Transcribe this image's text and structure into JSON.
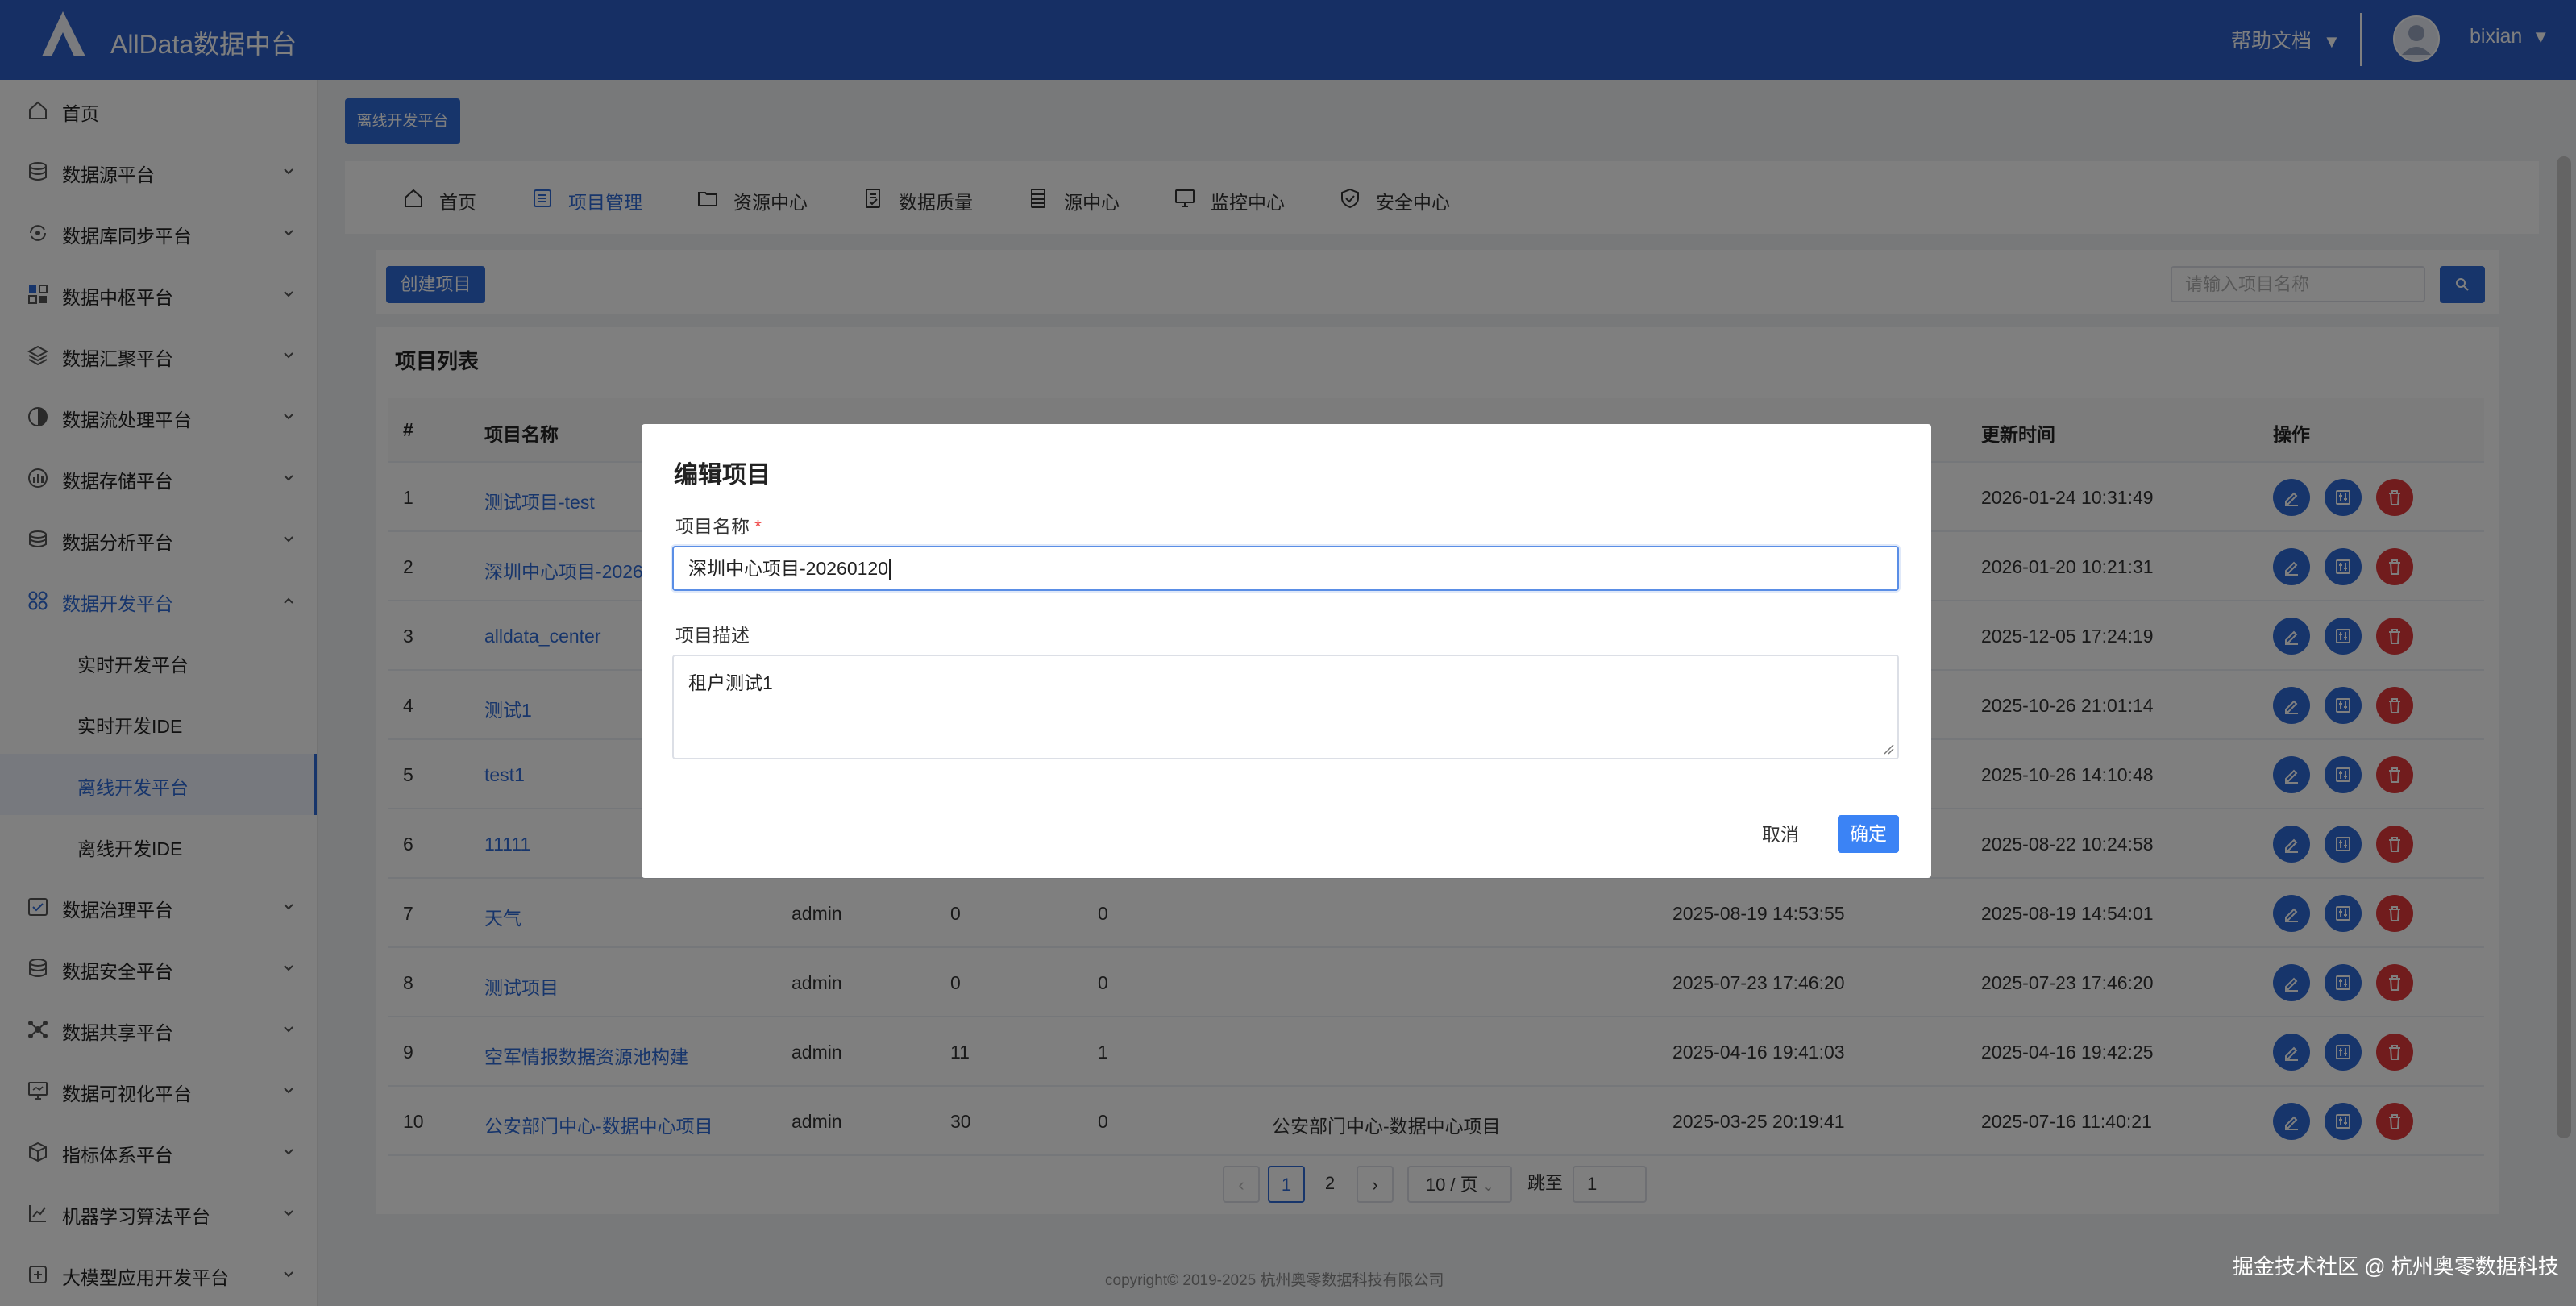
{
  "app": {
    "title": "AllData数据中台",
    "help_label": "帮助文档",
    "user_name": "bixian",
    "caret": "▼"
  },
  "sidebar": {
    "items": [
      {
        "label": "首页",
        "icon": "home-icon"
      },
      {
        "label": "数据源平台",
        "icon": "database-icon"
      },
      {
        "label": "数据库同步平台",
        "icon": "sync-icon"
      },
      {
        "label": "数据中枢平台",
        "icon": "grid-icon"
      },
      {
        "label": "数据汇聚平台",
        "icon": "layers-icon"
      },
      {
        "label": "数据流处理平台",
        "icon": "stream-icon"
      },
      {
        "label": "数据存储平台",
        "icon": "storage-icon"
      },
      {
        "label": "数据分析平台",
        "icon": "analysis-icon"
      },
      {
        "label": "数据开发平台",
        "icon": "apps-icon"
      },
      {
        "label": "实时开发平台"
      },
      {
        "label": "实时开发IDE"
      },
      {
        "label": "离线开发平台"
      },
      {
        "label": "离线开发IDE"
      },
      {
        "label": "数据治理平台",
        "icon": "governance-icon"
      },
      {
        "label": "数据安全平台",
        "icon": "security-icon"
      },
      {
        "label": "数据共享平台",
        "icon": "share-icon"
      },
      {
        "label": "数据可视化平台",
        "icon": "monitor-icon"
      },
      {
        "label": "指标体系平台",
        "icon": "cube-icon"
      },
      {
        "label": "机器学习算法平台",
        "icon": "ml-icon"
      },
      {
        "label": "大模型应用开发平台",
        "icon": "llm-icon"
      }
    ]
  },
  "page_tag": "离线开发平台",
  "topnav": {
    "items": [
      {
        "label": "首页",
        "icon": "home-icon"
      },
      {
        "label": "项目管理",
        "icon": "list-icon"
      },
      {
        "label": "资源中心",
        "icon": "folder-icon"
      },
      {
        "label": "数据质量",
        "icon": "doc-check-icon"
      },
      {
        "label": "源中心",
        "icon": "table-icon"
      },
      {
        "label": "监控中心",
        "icon": "monitor-icon"
      },
      {
        "label": "安全中心",
        "icon": "shield-icon"
      }
    ],
    "active": "项目管理"
  },
  "toolbar": {
    "create_label": "创建项目",
    "search_placeholder": "请输入项目名称"
  },
  "list": {
    "title": "项目列表",
    "columns": [
      "#",
      "项目名称",
      "更新时间",
      "操作"
    ],
    "rows": [
      {
        "no": "1",
        "name": "测试项目-test",
        "owner": "",
        "c1": "",
        "c2": "",
        "desc": "",
        "created": "",
        "updated": "2026-01-24 10:31:49"
      },
      {
        "no": "2",
        "name": "深圳中心项目-2026",
        "owner": "",
        "c1": "",
        "c2": "",
        "desc": "",
        "created": "",
        "updated": "2026-01-20 10:21:31"
      },
      {
        "no": "3",
        "name": "alldata_center",
        "owner": "",
        "c1": "",
        "c2": "",
        "desc": "",
        "created": "",
        "updated": "2025-12-05 17:24:19"
      },
      {
        "no": "4",
        "name": "测试1",
        "owner": "",
        "c1": "",
        "c2": "",
        "desc": "",
        "created": "",
        "updated": "2025-10-26 21:01:14"
      },
      {
        "no": "5",
        "name": "test1",
        "owner": "",
        "c1": "",
        "c2": "",
        "desc": "",
        "created": "",
        "updated": "2025-10-26 14:10:48"
      },
      {
        "no": "6",
        "name": "11111",
        "owner": "",
        "c1": "",
        "c2": "",
        "desc": "",
        "created": "",
        "updated": "2025-08-22 10:24:58"
      },
      {
        "no": "7",
        "name": "天气",
        "owner": "admin",
        "c1": "0",
        "c2": "0",
        "desc": "",
        "created": "2025-08-19 14:53:55",
        "updated": "2025-08-19 14:54:01"
      },
      {
        "no": "8",
        "name": "测试项目",
        "owner": "admin",
        "c1": "0",
        "c2": "0",
        "desc": "",
        "created": "2025-07-23 17:46:20",
        "updated": "2025-07-23 17:46:20"
      },
      {
        "no": "9",
        "name": "空军情报数据资源池构建",
        "owner": "admin",
        "c1": "11",
        "c2": "1",
        "desc": "",
        "created": "2025-04-16 19:41:03",
        "updated": "2025-04-16 19:42:25"
      },
      {
        "no": "10",
        "name": "公安部门中心-数据中心项目",
        "owner": "admin",
        "c1": "30",
        "c2": "0",
        "desc": "公安部门中心-数据中心项目",
        "created": "2025-03-25 20:19:41",
        "updated": "2025-07-16 11:40:21"
      }
    ]
  },
  "pagination": {
    "prev": "‹",
    "pages": [
      "1",
      "2"
    ],
    "current": "1",
    "next": "›",
    "page_size": "10 / 页",
    "jump_label": "跳至",
    "jump_value": "1"
  },
  "footer": "copyright© 2019-2025 杭州奥零数据科技有限公司",
  "watermark": "掘金技术社区 @ 杭州奥零数据科技",
  "dialog": {
    "title": "编辑项目",
    "name_label": "项目名称",
    "required_mark": "*",
    "name_value": "深圳中心项目-20260120",
    "desc_label": "项目描述",
    "desc_value": "租户测试1",
    "cancel_label": "取消",
    "ok_label": "确定"
  },
  "colors": {
    "header": "#2c5fc9",
    "primary": "#2f6bd7",
    "danger": "#e2393a"
  }
}
